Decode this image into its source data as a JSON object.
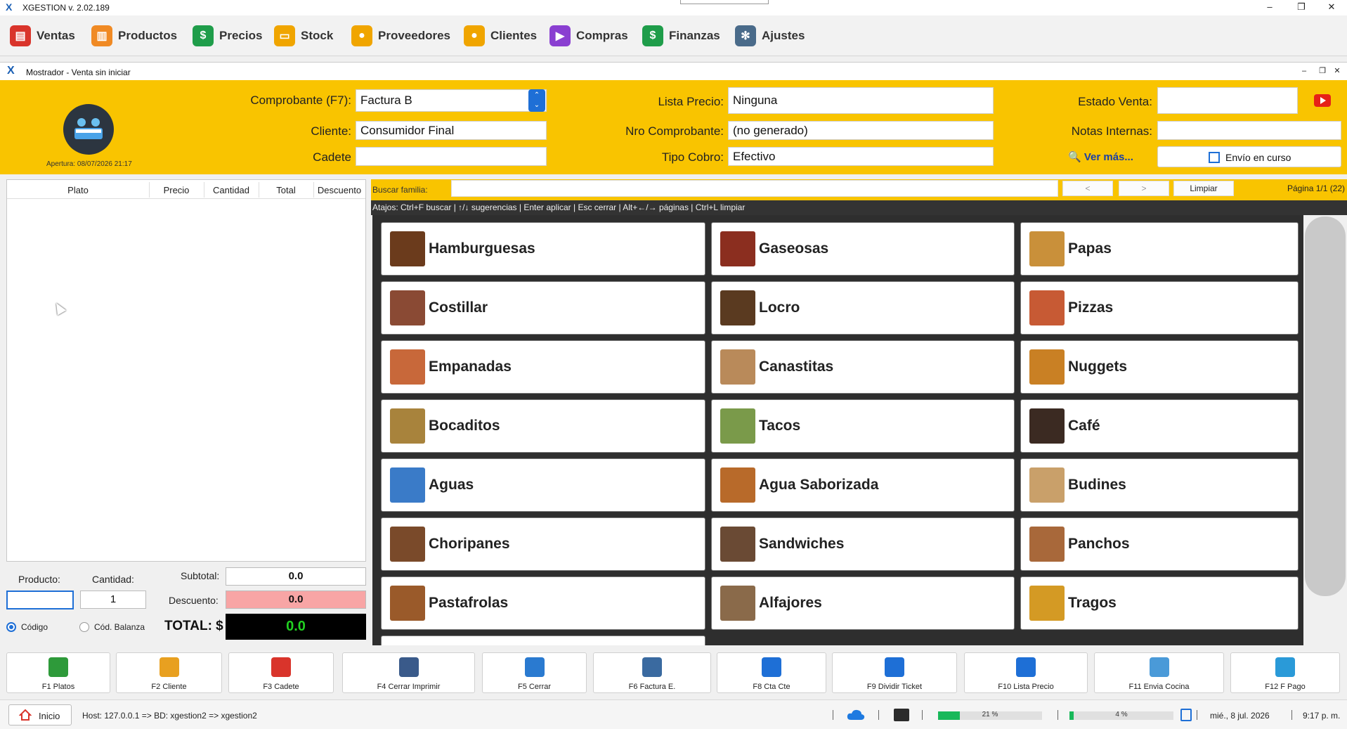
{
  "app": {
    "title": "XGESTION v. 2.02.189",
    "logo": "X",
    "window_controls": [
      "–",
      "❐",
      "✕"
    ]
  },
  "menu": [
    {
      "label": "Ventas",
      "icon": "store-icon",
      "color": "#d9342b"
    },
    {
      "label": "Productos",
      "icon": "gift-box-icon",
      "color": "#f08a24"
    },
    {
      "label": "Precios",
      "icon": "price-tag-icon",
      "color": "#1f9d4a"
    },
    {
      "label": "Stock",
      "icon": "cart-icon",
      "color": "#f0a500"
    },
    {
      "label": "Proveedores",
      "icon": "supplier-person-icon",
      "color": "#f0a500"
    },
    {
      "label": "Clientes",
      "icon": "client-person-icon",
      "color": "#f0a500"
    },
    {
      "label": "Compras",
      "icon": "delivery-truck-icon",
      "color": "#8a3fd1"
    },
    {
      "label": "Finanzas",
      "icon": "money-bag-icon",
      "color": "#1f9d4a"
    },
    {
      "label": "Ajustes",
      "icon": "gear-icon",
      "color": "#4a6b8a"
    }
  ],
  "subwindow": {
    "title": "Mostrador - Venta sin iniciar",
    "controls": [
      "–",
      "❐",
      "✕"
    ]
  },
  "header": {
    "apertura": "Apertura: 08/07/2026 21:17",
    "comprobante_label": "Comprobante (F7):",
    "comprobante_value": "Factura B",
    "cliente_label": "Cliente:",
    "cliente_value": "Consumidor Final",
    "cadete_label": "Cadete",
    "cadete_value": "",
    "lista_precio_label": "Lista Precio:",
    "lista_precio_value": "Ninguna",
    "nro_comprobante_label": "Nro Comprobante:",
    "nro_comprobante_value": "(no generado)",
    "tipo_cobro_label": "Tipo Cobro:",
    "tipo_cobro_value": "Efectivo",
    "estado_venta_label": "Estado Venta:",
    "estado_venta_value": "",
    "notas_label": "Notas Internas:",
    "notas_value": "",
    "ver_mas": "🔍 Ver más...",
    "envio_label": "Envío en curso",
    "accent": "#f9c400"
  },
  "order_table": {
    "columns": [
      "Plato",
      "Precio",
      "Cantidad",
      "Total",
      "Descuento"
    ],
    "rows": []
  },
  "entry": {
    "producto_label": "Producto:",
    "producto_value": "",
    "cantidad_label": "Cantidad:",
    "cantidad_value": "1",
    "codigo_label": "Código",
    "cod_balanza_label": "Cód. Balanza",
    "subtotal_label": "Subtotal:",
    "subtotal_value": "0.0",
    "descuento_label": "Descuento:",
    "descuento_value": "0.0",
    "total_label": "TOTAL: $",
    "total_value": "0.0"
  },
  "family_search": {
    "label": "Buscar familia:",
    "value": "",
    "prev": "<",
    "next": ">",
    "clear": "Limpiar",
    "page": "Página 1/1 (22)",
    "hint": "Atajos: Ctrl+F buscar | ↑/↓ sugerencias | Enter aplicar | Esc cerrar | Alt+←/→ páginas | Ctrl+L limpiar"
  },
  "families": [
    {
      "name": "Hamburguesas",
      "color": "#6b3b1c"
    },
    {
      "name": "Gaseosas",
      "color": "#8b2e1f"
    },
    {
      "name": "Papas",
      "color": "#c9903a"
    },
    {
      "name": "Costillar",
      "color": "#8a4a34"
    },
    {
      "name": "Locro",
      "color": "#5a3a20"
    },
    {
      "name": "Pizzas",
      "color": "#c75a34"
    },
    {
      "name": "Empanadas",
      "color": "#c8683a"
    },
    {
      "name": "Canastitas",
      "color": "#b98a5a"
    },
    {
      "name": "Nuggets",
      "color": "#c98024"
    },
    {
      "name": "Bocaditos",
      "color": "#a8833c"
    },
    {
      "name": "Tacos",
      "color": "#7a9a4a"
    },
    {
      "name": "Café",
      "color": "#3b2a22"
    },
    {
      "name": "Aguas",
      "color": "#3a7bc8"
    },
    {
      "name": "Agua Saborizada",
      "color": "#b86a2a"
    },
    {
      "name": "Budines",
      "color": "#c9a06a"
    },
    {
      "name": "Choripanes",
      "color": "#7a4a2a"
    },
    {
      "name": "Sandwiches",
      "color": "#6a4a34"
    },
    {
      "name": "Panchos",
      "color": "#a8683a"
    },
    {
      "name": "Pastafrolas",
      "color": "#9a5a2a"
    },
    {
      "name": "Alfajores",
      "color": "#8a6a4a"
    },
    {
      "name": "Tragos",
      "color": "#d49a24"
    }
  ],
  "function_keys": [
    {
      "label": "F1 Platos",
      "icon": "basket-icon",
      "color": "#2e9a3a"
    },
    {
      "label": "F2 Cliente",
      "icon": "client-icon",
      "color": "#e8a020"
    },
    {
      "label": "F3 Cadete",
      "icon": "courier-icon",
      "color": "#d9342b"
    },
    {
      "label": "F4 Cerrar Imprimir",
      "icon": "printer-icon",
      "color": "#3a5a8a"
    },
    {
      "label": "F5 Cerrar",
      "icon": "card-icon",
      "color": "#2a7ad0"
    },
    {
      "label": "F6 Factura E.",
      "icon": "invoice-printer-icon",
      "color": "#3a6aa0"
    },
    {
      "label": "F8 Cta Cte",
      "icon": "bank-icon",
      "color": "#1e6fd6"
    },
    {
      "label": "F9 Dividir Ticket",
      "icon": "split-icon",
      "color": "#1e6fd6"
    },
    {
      "label": "F10 Lista Precio",
      "icon": "price-list-icon",
      "color": "#1e6fd6"
    },
    {
      "label": "F11 Envia Cocina",
      "icon": "chef-hat-icon",
      "color": "#4a9ad8"
    },
    {
      "label": "F12 F Pago",
      "icon": "payment-card-icon",
      "color": "#2a9ad8"
    }
  ],
  "status": {
    "inicio": "Inicio",
    "host": "Host: 127.0.0.1 => BD: xgestion2 => xgestion2",
    "cpu_percent": "21 %",
    "cpu_fraction": 0.21,
    "mem_percent": "4 %",
    "mem_fraction": 0.04,
    "date": "mié., 8 jul. 2026",
    "time": "9:17 p. m."
  }
}
